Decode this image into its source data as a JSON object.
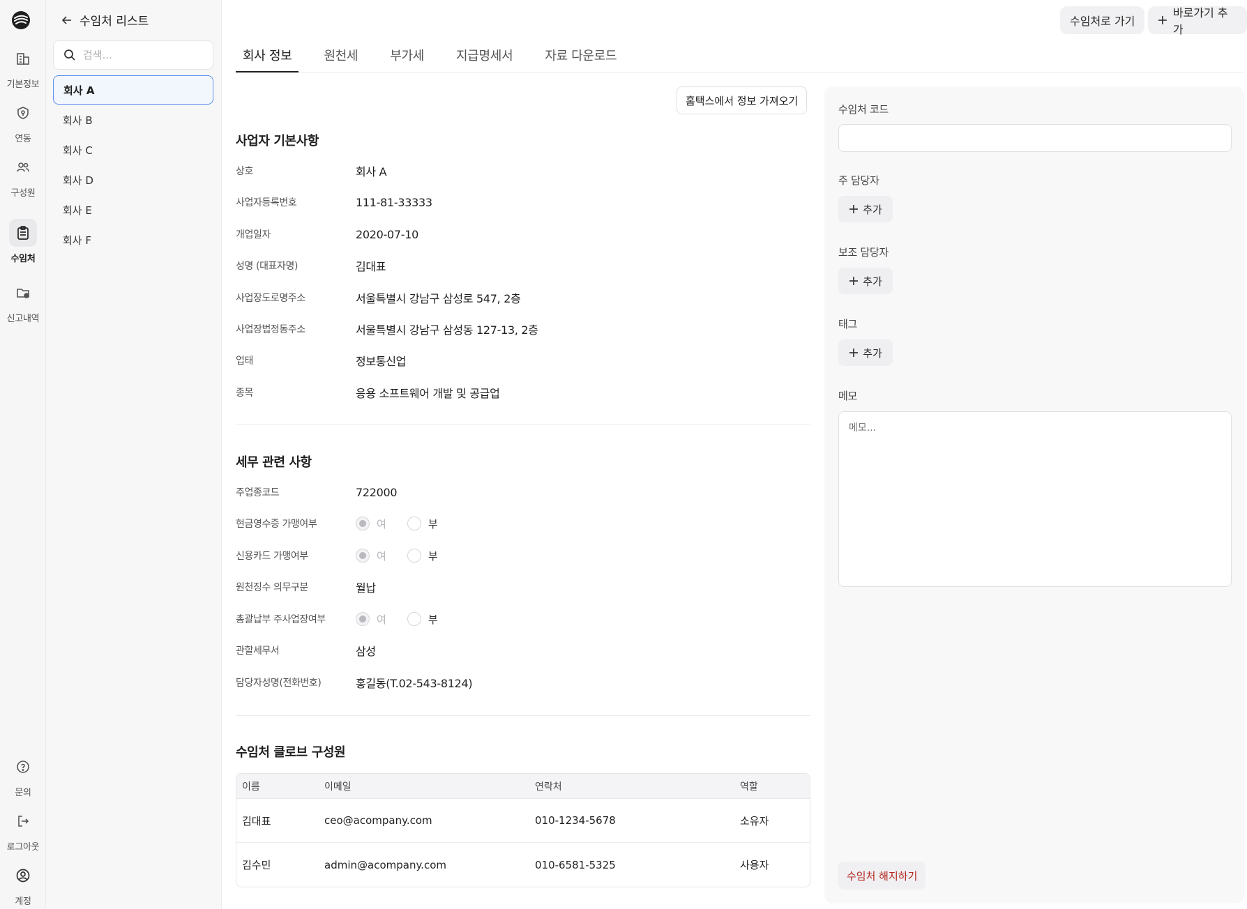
{
  "rail": {
    "items": [
      {
        "label": "기본정보",
        "icon": "building-icon"
      },
      {
        "label": "연동",
        "icon": "shield-link-icon"
      },
      {
        "label": "구성원",
        "icon": "users-icon"
      },
      {
        "label": "수임처",
        "icon": "clipboard-icon"
      },
      {
        "label": "신고내역",
        "icon": "folder-check-icon"
      }
    ],
    "bottom": [
      {
        "label": "문의",
        "icon": "help-icon"
      },
      {
        "label": "로그아웃",
        "icon": "logout-icon"
      },
      {
        "label": "계정",
        "icon": "account-icon"
      }
    ],
    "active_label": "수임처"
  },
  "list": {
    "back_label": "수임처 리스트",
    "search_placeholder": "검색...",
    "clients": [
      "회사 A",
      "회사 B",
      "회사 C",
      "회사 D",
      "회사 E",
      "회사 F"
    ],
    "active_client": "회사 A"
  },
  "top": {
    "goto_label": "수임처로 가기",
    "add_shortcut_label": "바로가기 추가"
  },
  "tabs": [
    "회사 정보",
    "원천세",
    "부가세",
    "지급명세서",
    "자료 다운로드"
  ],
  "main": {
    "hometax_button": "홈택스에서 정보 가져오기",
    "basic_title": "사업자 기본사항",
    "basic_rows": [
      {
        "k": "상호",
        "v": "회사 A"
      },
      {
        "k": "사업자등록번호",
        "v": "111-81-33333"
      },
      {
        "k": "개업일자",
        "v": "2020-07-10"
      },
      {
        "k": "성명 (대표자명)",
        "v": "김대표"
      },
      {
        "k": "사업장도로명주소",
        "v": "서울특별시 강남구 삼성로 547, 2층"
      },
      {
        "k": "사업장법정동주소",
        "v": "서울특별시 강남구 삼성동 127-13, 2층"
      },
      {
        "k": "업태",
        "v": "정보통신업"
      },
      {
        "k": "종목",
        "v": "응용 소프트웨어 개발 및 공급업"
      }
    ],
    "tax_title": "세무 관련 사항",
    "tax_rows": [
      {
        "k": "주업종코드",
        "v": "722000"
      },
      {
        "k": "현금영수증 가맹여부",
        "yes": "여",
        "no": "부"
      },
      {
        "k": "신용카드 가맹여부",
        "yes": "여",
        "no": "부"
      },
      {
        "k": "원천징수 의무구분",
        "v": "월납"
      },
      {
        "k": "총괄납부 주사업장여부",
        "yes": "여",
        "no": "부"
      },
      {
        "k": "관할세무서",
        "v": "삼성"
      },
      {
        "k": "담당자성명(전화번호)",
        "v": "홍길동(T.02-543-8124)"
      }
    ],
    "members_title": "수임처 클로브 구성원",
    "members_headers": [
      "이름",
      "이메일",
      "연락처",
      "역할"
    ],
    "members": [
      {
        "name": "김대표",
        "email": "ceo@acompany.com",
        "phone": "010-1234-5678",
        "role": "소유자"
      },
      {
        "name": "김수민",
        "email": "admin@acompany.com",
        "phone": "010-6581-5325",
        "role": "사용자"
      }
    ]
  },
  "right": {
    "code_label": "수임처 코드",
    "code_value": "",
    "main_manager_label": "주 담당자",
    "sub_manager_label": "보조 담당자",
    "tag_label": "태그",
    "add_label": "추가",
    "memo_label": "메모",
    "memo_placeholder": "메모...",
    "terminate_label": "수임처 해지하기"
  },
  "colors": {
    "accent": "#5b8def",
    "danger": "#b3261e",
    "rail_bg": "#f6f6f7"
  }
}
